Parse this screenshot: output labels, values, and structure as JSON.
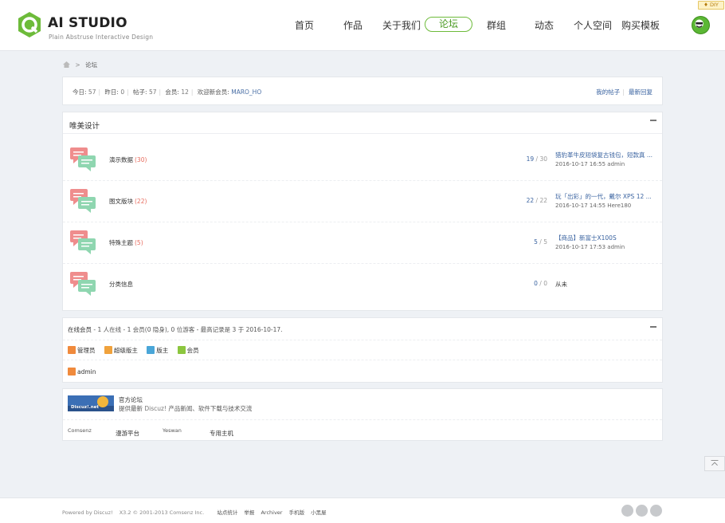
{
  "header": {
    "logo_title": "AI STUDIO",
    "logo_subtitle": "Plain Abstruse Interactive Design",
    "nav": [
      {
        "label": "首页"
      },
      {
        "label": "作品"
      },
      {
        "label": "关于我们"
      },
      {
        "label": "论坛",
        "active": true
      },
      {
        "label": "群组"
      },
      {
        "label": "动态"
      },
      {
        "label": "个人空间"
      },
      {
        "label": "购买模板"
      }
    ],
    "diy_label": "♦ DIY",
    "accent_color": "#6dbb3a"
  },
  "breadcrumb": {
    "sep": ">",
    "current": "论坛"
  },
  "stats": {
    "today_label": "今日:",
    "today": "57",
    "yesterday_label": "昨日:",
    "yesterday": "0",
    "posts_label": "帖子:",
    "posts": "57",
    "members_label": "会员:",
    "members": "12",
    "welcome_label": "欢迎新会员:",
    "newest_member": "MARO_HO",
    "my_posts": "我的帖子",
    "latest_replies": "最新回复"
  },
  "category": {
    "title": "唯美设计",
    "forums": [
      {
        "name": "演示数据",
        "count": "(30)",
        "threads": "19",
        "posts": "30",
        "last_title": "猎豹革牛皮短袋复古钱包，短款真 ...",
        "last_meta": "2016-10-17 16:55 admin"
      },
      {
        "name": "图文版块",
        "count": "(22)",
        "threads": "22",
        "posts": "22",
        "last_title": "玩「出彩」的一代，戴尔 XPS 12 ...",
        "last_meta": "2016-10-17 14:55 Here180"
      },
      {
        "name": "特殊主题",
        "count": "(5)",
        "threads": "5",
        "posts": "5",
        "last_title": "【商品】新富士X100S",
        "last_meta": "2016-10-17 17:53 admin"
      },
      {
        "name": "分类信息",
        "count": "",
        "threads": "0",
        "posts": "0",
        "last_title": "从未",
        "last_meta": ""
      }
    ]
  },
  "online": {
    "label": "在线会员",
    "summary": "- 1 人在线 - 1 会员(0 隐身), 0 位游客 - 最高记录是 3 于 2016-10-17.",
    "legend": [
      {
        "label": "管理员",
        "color": "#f08a3c"
      },
      {
        "label": "超级版主",
        "color": "#f0a23c"
      },
      {
        "label": "版主",
        "color": "#4aa6d8"
      },
      {
        "label": "会员",
        "color": "#8cc63f"
      }
    ],
    "users": [
      "admin"
    ]
  },
  "links": {
    "logo_text": "Discuz!.net",
    "title": "官方论坛",
    "desc_prefix": "提供最新",
    "desc_highlight": "Discuz!",
    "desc_suffix": "产品新闻、软件下载与技术交流",
    "friends": [
      "Comsenz",
      "漫游平台",
      "Yeswan",
      "专用主机"
    ]
  },
  "footer": {
    "powered": "Powered by Discuz!",
    "version": "X3.2 © 2001-2013 Comsenz Inc.",
    "links": [
      "站点统计",
      "举报",
      "Archiver",
      "手机版",
      "小黑屋"
    ]
  }
}
